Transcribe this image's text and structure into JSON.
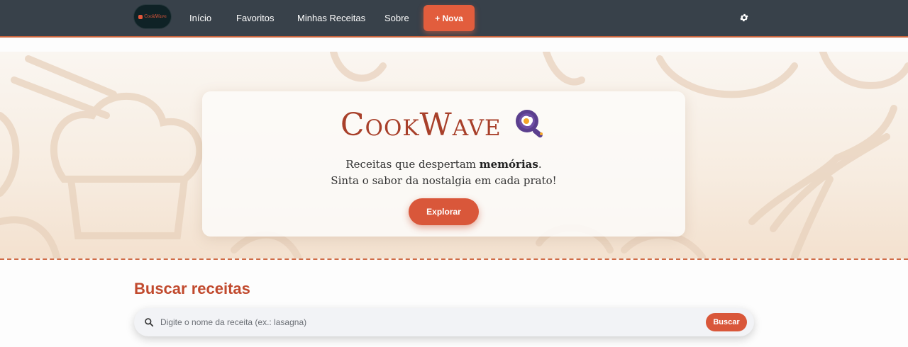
{
  "navbar": {
    "logo_text": "CookWave",
    "links": [
      "Início",
      "Favoritos",
      "Minhas Receitas",
      "Sobre"
    ],
    "new_button": "+ Nova",
    "settings_icon": "gear-icon"
  },
  "hero": {
    "brand_name": "CookWave",
    "brand_icon": "frying-pan-egg-icon",
    "tagline_part1": "Receitas que despertam ",
    "tagline_bold": "memórias",
    "tagline_part2": ".",
    "tagline_line2": "Sinta o sabor da nostalgia em cada prato!",
    "cta_label": "Explorar"
  },
  "search": {
    "title": "Buscar receitas",
    "placeholder": "Digite o nome da receita (ex.: lasagna)",
    "button_label": "Buscar",
    "icon": "search-icon"
  },
  "colors": {
    "navbar_bg": "#38414a",
    "accent": "#d9573a",
    "brand": "#a8402a"
  }
}
